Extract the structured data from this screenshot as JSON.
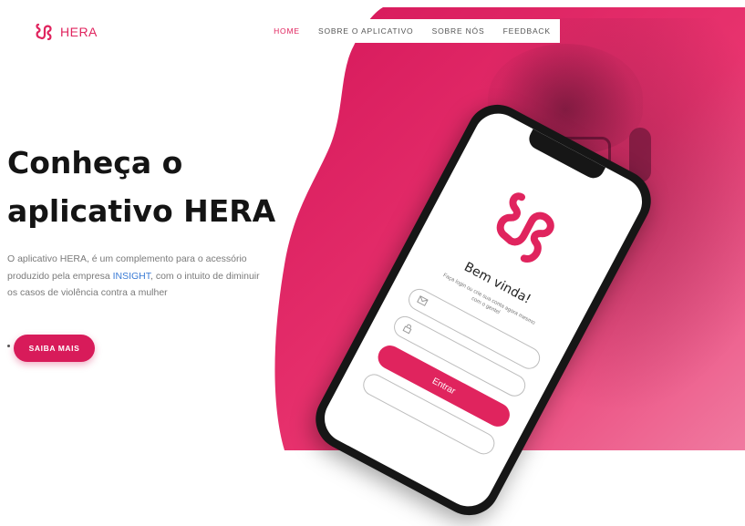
{
  "brand": {
    "name": "HERA",
    "color": "#e0245e"
  },
  "nav": {
    "items": [
      {
        "label": "HOME",
        "active": true
      },
      {
        "label": "SOBRE O APLICATIVO",
        "active": false
      },
      {
        "label": "SOBRE NÓS",
        "active": false
      },
      {
        "label": "FEEDBACK",
        "active": false
      }
    ]
  },
  "hero": {
    "title_line1": "Conheça o",
    "title_line2": "aplicativo HERA",
    "desc_before": "O aplicativo HERA, é um complemento para o acessório produzido pela empresa ",
    "desc_link": "INSIGHT",
    "desc_after": ", com o intuito de diminuir os casos de violência contra a mulher",
    "cta_label": "SAIBA MAIS",
    "bg_color": "#e8336e"
  },
  "phone": {
    "welcome": "Bem vinda!",
    "subtitle": "Faça login ou crie sua conta agora mesmo com o gentel",
    "email_icon": "mail-icon",
    "password_icon": "lock-icon",
    "enter_label": "Entrar"
  }
}
